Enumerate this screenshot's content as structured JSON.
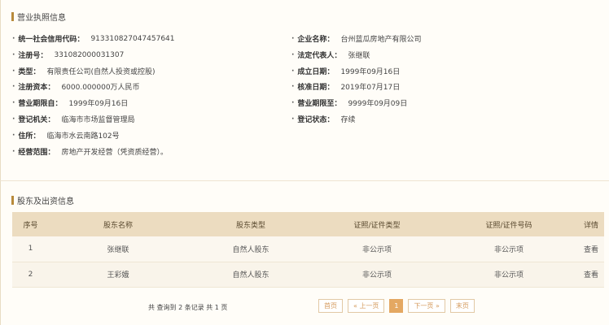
{
  "sections": {
    "license_title": "营业执照信息",
    "shareholder_title": "股东及出资信息"
  },
  "license": {
    "credit_code_label": "统一社会信用代码：",
    "credit_code": "913310827047457641",
    "company_name_label": "企业名称：",
    "company_name": "台州蓝瓜房地产有限公司",
    "reg_no_label": "注册号：",
    "reg_no": "331082000031307",
    "legal_rep_label": "法定代表人：",
    "legal_rep": "张继联",
    "type_label": "类型：",
    "type": "有限责任公司(自然人投资或控股)",
    "established_label": "成立日期：",
    "established": "1999年09月16日",
    "capital_label": "注册资本：",
    "capital": "6000.000000万人民币",
    "approved_label": "核准日期：",
    "approved": "2019年07月17日",
    "term_from_label": "营业期限自：",
    "term_from": "1999年09月16日",
    "term_to_label": "营业期限至：",
    "term_to": "9999年09月09日",
    "authority_label": "登记机关：",
    "authority": "临海市市场监督管理局",
    "status_label": "登记状态：",
    "status": "存续",
    "address_label": "住所：",
    "address": "临海市水云南路102号",
    "scope_label": "经营范围：",
    "scope": "房地产开发经营（凭资质经营）。"
  },
  "table": {
    "headers": [
      "序号",
      "股东名称",
      "股东类型",
      "证照/证件类型",
      "证照/证件号码",
      "详情"
    ],
    "rows": [
      [
        "1",
        "张继联",
        "自然人股东",
        "非公示项",
        "非公示项",
        "查看"
      ],
      [
        "2",
        "王彩娥",
        "自然人股东",
        "非公示项",
        "非公示项",
        "查看"
      ]
    ]
  },
  "pager": {
    "summary": "共 查询到 2 条记录 共 1 页",
    "first": "首页",
    "prev": "« 上一页",
    "current": "1",
    "next": "下一页 »",
    "last": "末页"
  }
}
